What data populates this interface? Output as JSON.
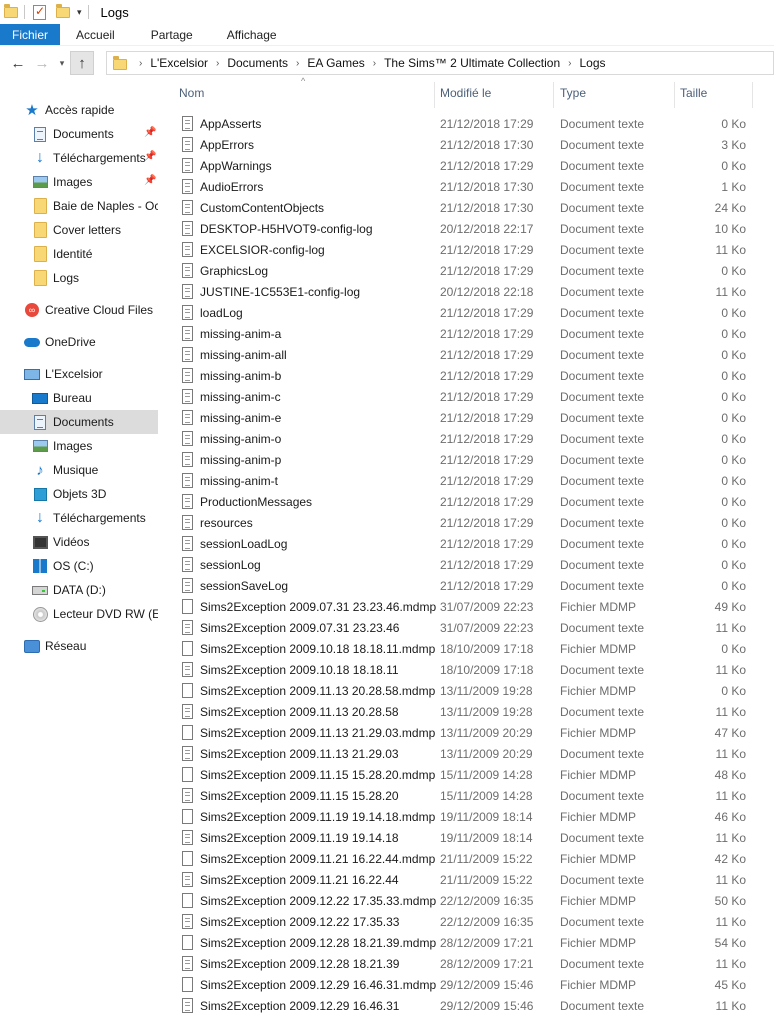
{
  "window": {
    "title": "Logs"
  },
  "ribbon": {
    "tabs": [
      "Fichier",
      "Accueil",
      "Partage",
      "Affichage"
    ]
  },
  "address": {
    "crumbs": [
      "L'Excelsior",
      "Documents",
      "EA Games",
      "The Sims™ 2 Ultimate Collection",
      "Logs"
    ]
  },
  "sidebar": {
    "items": [
      {
        "label": "Accès rapide",
        "icon": "star-icon",
        "pinned": false
      },
      {
        "label": "Documents",
        "icon": "document-folder-icon",
        "pinned": true
      },
      {
        "label": "Téléchargements",
        "icon": "download-icon",
        "pinned": true
      },
      {
        "label": "Images",
        "icon": "pictures-icon",
        "pinned": true
      },
      {
        "label": "Baie de Naples - Oct",
        "icon": "folder-icon",
        "pinned": false
      },
      {
        "label": "Cover letters",
        "icon": "folder-icon",
        "pinned": false
      },
      {
        "label": "Identité",
        "icon": "folder-icon",
        "pinned": false
      },
      {
        "label": "Logs",
        "icon": "folder-icon",
        "pinned": false
      },
      {
        "label": "Creative Cloud Files",
        "icon": "creative-cloud-icon",
        "pinned": false
      },
      {
        "label": "OneDrive",
        "icon": "onedrive-cloud-icon",
        "pinned": false
      },
      {
        "label": "L'Excelsior",
        "icon": "this-pc-icon",
        "pinned": false
      },
      {
        "label": "Bureau",
        "icon": "desktop-icon",
        "pinned": false
      },
      {
        "label": "Documents",
        "icon": "document-folder-icon",
        "pinned": false,
        "selected": true
      },
      {
        "label": "Images",
        "icon": "pictures-icon",
        "pinned": false
      },
      {
        "label": "Musique",
        "icon": "music-icon",
        "pinned": false
      },
      {
        "label": "Objets 3D",
        "icon": "3d-objects-icon",
        "pinned": false
      },
      {
        "label": "Téléchargements",
        "icon": "download-icon",
        "pinned": false
      },
      {
        "label": "Vidéos",
        "icon": "video-icon",
        "pinned": false
      },
      {
        "label": "OS (C:)",
        "icon": "windows-drive-icon",
        "pinned": false
      },
      {
        "label": "DATA (D:)",
        "icon": "drive-icon",
        "pinned": false
      },
      {
        "label": "Lecteur DVD RW (E:)",
        "icon": "dvd-drive-icon",
        "pinned": false
      },
      {
        "label": "Réseau",
        "icon": "network-icon",
        "pinned": false
      }
    ]
  },
  "columns": {
    "name": "Nom",
    "modified": "Modifié le",
    "type": "Type",
    "size": "Taille"
  },
  "files": [
    {
      "name": "AppAsserts",
      "date": "21/12/2018 17:29",
      "type": "Document texte",
      "size": "0 Ko"
    },
    {
      "name": "AppErrors",
      "date": "21/12/2018 17:30",
      "type": "Document texte",
      "size": "3 Ko"
    },
    {
      "name": "AppWarnings",
      "date": "21/12/2018 17:29",
      "type": "Document texte",
      "size": "0 Ko"
    },
    {
      "name": "AudioErrors",
      "date": "21/12/2018 17:30",
      "type": "Document texte",
      "size": "1 Ko"
    },
    {
      "name": "CustomContentObjects",
      "date": "21/12/2018 17:30",
      "type": "Document texte",
      "size": "24 Ko"
    },
    {
      "name": "DESKTOP-H5HVOT9-config-log",
      "date": "20/12/2018 22:17",
      "type": "Document texte",
      "size": "10 Ko"
    },
    {
      "name": "EXCELSIOR-config-log",
      "date": "21/12/2018 17:29",
      "type": "Document texte",
      "size": "11 Ko"
    },
    {
      "name": "GraphicsLog",
      "date": "21/12/2018 17:29",
      "type": "Document texte",
      "size": "0 Ko"
    },
    {
      "name": "JUSTINE-1C553E1-config-log",
      "date": "20/12/2018 22:18",
      "type": "Document texte",
      "size": "11 Ko"
    },
    {
      "name": "loadLog",
      "date": "21/12/2018 17:29",
      "type": "Document texte",
      "size": "0 Ko"
    },
    {
      "name": "missing-anim-a",
      "date": "21/12/2018 17:29",
      "type": "Document texte",
      "size": "0 Ko"
    },
    {
      "name": "missing-anim-all",
      "date": "21/12/2018 17:29",
      "type": "Document texte",
      "size": "0 Ko"
    },
    {
      "name": "missing-anim-b",
      "date": "21/12/2018 17:29",
      "type": "Document texte",
      "size": "0 Ko"
    },
    {
      "name": "missing-anim-c",
      "date": "21/12/2018 17:29",
      "type": "Document texte",
      "size": "0 Ko"
    },
    {
      "name": "missing-anim-e",
      "date": "21/12/2018 17:29",
      "type": "Document texte",
      "size": "0 Ko"
    },
    {
      "name": "missing-anim-o",
      "date": "21/12/2018 17:29",
      "type": "Document texte",
      "size": "0 Ko"
    },
    {
      "name": "missing-anim-p",
      "date": "21/12/2018 17:29",
      "type": "Document texte",
      "size": "0 Ko"
    },
    {
      "name": "missing-anim-t",
      "date": "21/12/2018 17:29",
      "type": "Document texte",
      "size": "0 Ko"
    },
    {
      "name": "ProductionMessages",
      "date": "21/12/2018 17:29",
      "type": "Document texte",
      "size": "0 Ko"
    },
    {
      "name": "resources",
      "date": "21/12/2018 17:29",
      "type": "Document texte",
      "size": "0 Ko"
    },
    {
      "name": "sessionLoadLog",
      "date": "21/12/2018 17:29",
      "type": "Document texte",
      "size": "0 Ko"
    },
    {
      "name": "sessionLog",
      "date": "21/12/2018 17:29",
      "type": "Document texte",
      "size": "0 Ko"
    },
    {
      "name": "sessionSaveLog",
      "date": "21/12/2018 17:29",
      "type": "Document texte",
      "size": "0 Ko"
    },
    {
      "name": "Sims2Exception 2009.07.31 23.23.46.mdmp",
      "date": "31/07/2009 22:23",
      "type": "Fichier MDMP",
      "size": "49 Ko"
    },
    {
      "name": "Sims2Exception 2009.07.31 23.23.46",
      "date": "31/07/2009 22:23",
      "type": "Document texte",
      "size": "11 Ko"
    },
    {
      "name": "Sims2Exception 2009.10.18 18.18.11.mdmp",
      "date": "18/10/2009 17:18",
      "type": "Fichier MDMP",
      "size": "0 Ko"
    },
    {
      "name": "Sims2Exception 2009.10.18 18.18.11",
      "date": "18/10/2009 17:18",
      "type": "Document texte",
      "size": "11 Ko"
    },
    {
      "name": "Sims2Exception 2009.11.13 20.28.58.mdmp",
      "date": "13/11/2009 19:28",
      "type": "Fichier MDMP",
      "size": "0 Ko"
    },
    {
      "name": "Sims2Exception 2009.11.13 20.28.58",
      "date": "13/11/2009 19:28",
      "type": "Document texte",
      "size": "11 Ko"
    },
    {
      "name": "Sims2Exception 2009.11.13 21.29.03.mdmp",
      "date": "13/11/2009 20:29",
      "type": "Fichier MDMP",
      "size": "47 Ko"
    },
    {
      "name": "Sims2Exception 2009.11.13 21.29.03",
      "date": "13/11/2009 20:29",
      "type": "Document texte",
      "size": "11 Ko"
    },
    {
      "name": "Sims2Exception 2009.11.15 15.28.20.mdmp",
      "date": "15/11/2009 14:28",
      "type": "Fichier MDMP",
      "size": "48 Ko"
    },
    {
      "name": "Sims2Exception 2009.11.15 15.28.20",
      "date": "15/11/2009 14:28",
      "type": "Document texte",
      "size": "11 Ko"
    },
    {
      "name": "Sims2Exception 2009.11.19 19.14.18.mdmp",
      "date": "19/11/2009 18:14",
      "type": "Fichier MDMP",
      "size": "46 Ko"
    },
    {
      "name": "Sims2Exception 2009.11.19 19.14.18",
      "date": "19/11/2009 18:14",
      "type": "Document texte",
      "size": "11 Ko"
    },
    {
      "name": "Sims2Exception 2009.11.21 16.22.44.mdmp",
      "date": "21/11/2009 15:22",
      "type": "Fichier MDMP",
      "size": "42 Ko"
    },
    {
      "name": "Sims2Exception 2009.11.21 16.22.44",
      "date": "21/11/2009 15:22",
      "type": "Document texte",
      "size": "11 Ko"
    },
    {
      "name": "Sims2Exception 2009.12.22 17.35.33.mdmp",
      "date": "22/12/2009 16:35",
      "type": "Fichier MDMP",
      "size": "50 Ko"
    },
    {
      "name": "Sims2Exception 2009.12.22 17.35.33",
      "date": "22/12/2009 16:35",
      "type": "Document texte",
      "size": "11 Ko"
    },
    {
      "name": "Sims2Exception 2009.12.28 18.21.39.mdmp",
      "date": "28/12/2009 17:21",
      "type": "Fichier MDMP",
      "size": "54 Ko"
    },
    {
      "name": "Sims2Exception 2009.12.28 18.21.39",
      "date": "28/12/2009 17:21",
      "type": "Document texte",
      "size": "11 Ko"
    },
    {
      "name": "Sims2Exception 2009.12.29 16.46.31.mdmp",
      "date": "29/12/2009 15:46",
      "type": "Fichier MDMP",
      "size": "45 Ko"
    },
    {
      "name": "Sims2Exception 2009.12.29 16.46.31",
      "date": "29/12/2009 15:46",
      "type": "Document texte",
      "size": "11 Ko"
    }
  ],
  "colors": {
    "file_tab": "#1979ca",
    "selected_nav": "#dcdcdc",
    "header_text": "#4c607a",
    "secondary_text": "#6d6d6d"
  }
}
